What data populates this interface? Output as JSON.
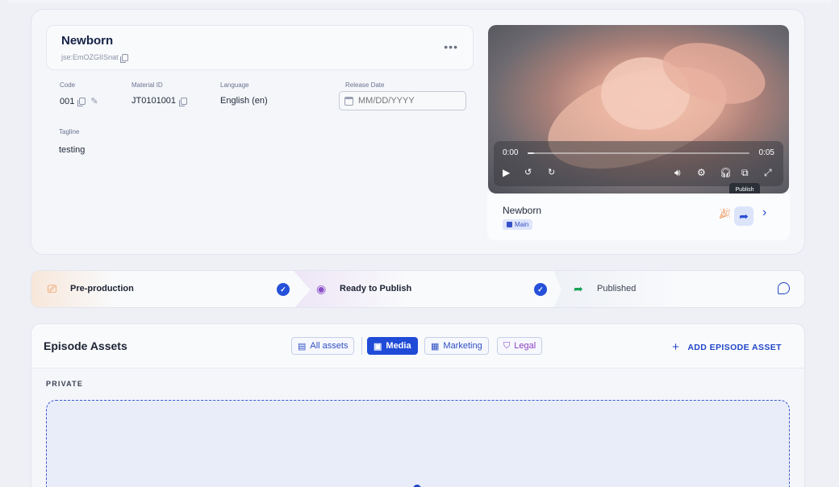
{
  "episode": {
    "title": "Newborn",
    "id": "jse:EmOZGIISnat",
    "more_label": "•••"
  },
  "fields": {
    "code_label": "Code",
    "code_value": "001",
    "material_label": "Material ID",
    "material_value": "JT0101001",
    "language_label": "Language",
    "language_value": "English (en)",
    "release_label": "Release Date",
    "release_placeholder": "MM/DD/YYYY",
    "tagline_label": "Tagline",
    "tagline_value": "testing"
  },
  "video": {
    "time_current": "0:00",
    "time_total": "0:05",
    "progress": 0.0,
    "title": "Newborn",
    "badge": "Main",
    "tooltip": "Publish"
  },
  "stages": [
    {
      "label": "Pre-production",
      "done": true
    },
    {
      "label": "Ready to Publish",
      "done": true
    },
    {
      "label": "Published",
      "done": false
    }
  ],
  "assets": {
    "title": "Episode Assets",
    "filters": [
      "All assets",
      "Media",
      "Marketing",
      "Legal"
    ],
    "active_filter": "Media",
    "add_label": "ADD EPISODE ASSET",
    "section_label": "PRIVATE"
  },
  "colors": {
    "accent": "#1f4bd7",
    "stage1_accent": "#e8823a",
    "stage2_accent": "#8a4fc8",
    "stage3_accent": "#18a058"
  }
}
